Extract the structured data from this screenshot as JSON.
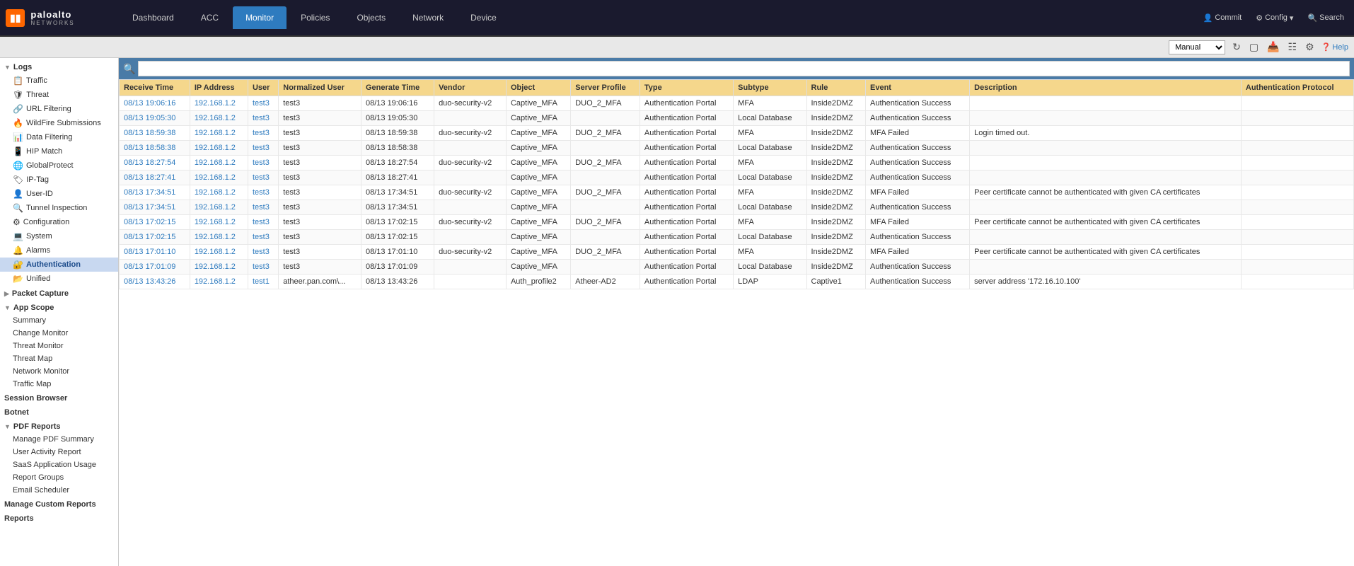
{
  "topbar": {
    "logo": "paloalto",
    "logo_sub": "NETWORKS",
    "nav_tabs": [
      {
        "label": "Dashboard",
        "active": false
      },
      {
        "label": "ACC",
        "active": false
      },
      {
        "label": "Monitor",
        "active": true
      },
      {
        "label": "Policies",
        "active": false
      },
      {
        "label": "Objects",
        "active": false
      },
      {
        "label": "Network",
        "active": false
      },
      {
        "label": "Device",
        "active": false
      }
    ],
    "commit_label": "Commit",
    "config_label": "Config",
    "search_label": "Search",
    "help_label": "Help",
    "manual_label": "Manual"
  },
  "sidebar": {
    "logs_section": {
      "label": "Logs",
      "items": [
        {
          "label": "Traffic",
          "icon": "📋"
        },
        {
          "label": "Threat",
          "icon": "🛡"
        },
        {
          "label": "URL Filtering",
          "icon": "🔗"
        },
        {
          "label": "WildFire Submissions",
          "icon": "🔥"
        },
        {
          "label": "Data Filtering",
          "icon": "📊"
        },
        {
          "label": "HIP Match",
          "icon": "📱"
        },
        {
          "label": "GlobalProtect",
          "icon": "🌐"
        },
        {
          "label": "IP-Tag",
          "icon": "🏷"
        },
        {
          "label": "User-ID",
          "icon": "👤"
        },
        {
          "label": "Tunnel Inspection",
          "icon": "🔍"
        },
        {
          "label": "Configuration",
          "icon": "⚙"
        },
        {
          "label": "System",
          "icon": "💻"
        },
        {
          "label": "Alarms",
          "icon": "🔔"
        },
        {
          "label": "Authentication",
          "icon": "🔐",
          "active": true
        },
        {
          "label": "Unified",
          "icon": "📂"
        }
      ]
    },
    "packet_capture": {
      "label": "Packet Capture"
    },
    "app_scope": {
      "label": "App Scope",
      "items": [
        {
          "label": "Summary"
        },
        {
          "label": "Change Monitor"
        },
        {
          "label": "Threat Monitor"
        },
        {
          "label": "Threat Map"
        },
        {
          "label": "Network Monitor"
        },
        {
          "label": "Traffic Map"
        }
      ]
    },
    "session_browser": {
      "label": "Session Browser"
    },
    "botnet": {
      "label": "Botnet"
    },
    "pdf_reports": {
      "label": "PDF Reports",
      "items": [
        {
          "label": "Manage PDF Summary"
        },
        {
          "label": "User Activity Report"
        },
        {
          "label": "SaaS Application Usage"
        },
        {
          "label": "Report Groups"
        },
        {
          "label": "Email Scheduler"
        }
      ]
    },
    "custom_reports": {
      "label": "Manage Custom Reports"
    },
    "reports": {
      "label": "Reports"
    }
  },
  "table": {
    "columns": [
      "Receive Time",
      "IP Address",
      "User",
      "Normalized User",
      "Generate Time",
      "Vendor",
      "Object",
      "Server Profile",
      "Type",
      "Subtype",
      "Rule",
      "Event",
      "Description",
      "Authentication Protocol"
    ],
    "rows": [
      {
        "receive_time": "08/13 19:06:16",
        "ip_address": "192.168.1.2",
        "user": "test3",
        "normalized_user": "test3",
        "generate_time": "08/13 19:06:16",
        "vendor": "duo-security-v2",
        "object": "Captive_MFA",
        "server_profile": "DUO_2_MFA",
        "type": "Authentication Portal",
        "subtype": "MFA",
        "rule": "Inside2DMZ",
        "event": "Authentication Success",
        "description": "",
        "auth_protocol": ""
      },
      {
        "receive_time": "08/13 19:05:30",
        "ip_address": "192.168.1.2",
        "user": "test3",
        "normalized_user": "test3",
        "generate_time": "08/13 19:05:30",
        "vendor": "",
        "object": "Captive_MFA",
        "server_profile": "",
        "type": "Authentication Portal",
        "subtype": "Local Database",
        "rule": "Inside2DMZ",
        "event": "Authentication Success",
        "description": "",
        "auth_protocol": ""
      },
      {
        "receive_time": "08/13 18:59:38",
        "ip_address": "192.168.1.2",
        "user": "test3",
        "normalized_user": "test3",
        "generate_time": "08/13 18:59:38",
        "vendor": "duo-security-v2",
        "object": "Captive_MFA",
        "server_profile": "DUO_2_MFA",
        "type": "Authentication Portal",
        "subtype": "MFA",
        "rule": "Inside2DMZ",
        "event": "MFA Failed",
        "description": "Login timed out.",
        "auth_protocol": ""
      },
      {
        "receive_time": "08/13 18:58:38",
        "ip_address": "192.168.1.2",
        "user": "test3",
        "normalized_user": "test3",
        "generate_time": "08/13 18:58:38",
        "vendor": "",
        "object": "Captive_MFA",
        "server_profile": "",
        "type": "Authentication Portal",
        "subtype": "Local Database",
        "rule": "Inside2DMZ",
        "event": "Authentication Success",
        "description": "",
        "auth_protocol": ""
      },
      {
        "receive_time": "08/13 18:27:54",
        "ip_address": "192.168.1.2",
        "user": "test3",
        "normalized_user": "test3",
        "generate_time": "08/13 18:27:54",
        "vendor": "duo-security-v2",
        "object": "Captive_MFA",
        "server_profile": "DUO_2_MFA",
        "type": "Authentication Portal",
        "subtype": "MFA",
        "rule": "Inside2DMZ",
        "event": "Authentication Success",
        "description": "",
        "auth_protocol": ""
      },
      {
        "receive_time": "08/13 18:27:41",
        "ip_address": "192.168.1.2",
        "user": "test3",
        "normalized_user": "test3",
        "generate_time": "08/13 18:27:41",
        "vendor": "",
        "object": "Captive_MFA",
        "server_profile": "",
        "type": "Authentication Portal",
        "subtype": "Local Database",
        "rule": "Inside2DMZ",
        "event": "Authentication Success",
        "description": "",
        "auth_protocol": ""
      },
      {
        "receive_time": "08/13 17:34:51",
        "ip_address": "192.168.1.2",
        "user": "test3",
        "normalized_user": "test3",
        "generate_time": "08/13 17:34:51",
        "vendor": "duo-security-v2",
        "object": "Captive_MFA",
        "server_profile": "DUO_2_MFA",
        "type": "Authentication Portal",
        "subtype": "MFA",
        "rule": "Inside2DMZ",
        "event": "MFA Failed",
        "description": "Peer certificate cannot be authenticated with given CA certificates",
        "auth_protocol": ""
      },
      {
        "receive_time": "08/13 17:34:51",
        "ip_address": "192.168.1.2",
        "user": "test3",
        "normalized_user": "test3",
        "generate_time": "08/13 17:34:51",
        "vendor": "",
        "object": "Captive_MFA",
        "server_profile": "",
        "type": "Authentication Portal",
        "subtype": "Local Database",
        "rule": "Inside2DMZ",
        "event": "Authentication Success",
        "description": "",
        "auth_protocol": ""
      },
      {
        "receive_time": "08/13 17:02:15",
        "ip_address": "192.168.1.2",
        "user": "test3",
        "normalized_user": "test3",
        "generate_time": "08/13 17:02:15",
        "vendor": "duo-security-v2",
        "object": "Captive_MFA",
        "server_profile": "DUO_2_MFA",
        "type": "Authentication Portal",
        "subtype": "MFA",
        "rule": "Inside2DMZ",
        "event": "MFA Failed",
        "description": "Peer certificate cannot be authenticated with given CA certificates",
        "auth_protocol": ""
      },
      {
        "receive_time": "08/13 17:02:15",
        "ip_address": "192.168.1.2",
        "user": "test3",
        "normalized_user": "test3",
        "generate_time": "08/13 17:02:15",
        "vendor": "",
        "object": "Captive_MFA",
        "server_profile": "",
        "type": "Authentication Portal",
        "subtype": "Local Database",
        "rule": "Inside2DMZ",
        "event": "Authentication Success",
        "description": "",
        "auth_protocol": ""
      },
      {
        "receive_time": "08/13 17:01:10",
        "ip_address": "192.168.1.2",
        "user": "test3",
        "normalized_user": "test3",
        "generate_time": "08/13 17:01:10",
        "vendor": "duo-security-v2",
        "object": "Captive_MFA",
        "server_profile": "DUO_2_MFA",
        "type": "Authentication Portal",
        "subtype": "MFA",
        "rule": "Inside2DMZ",
        "event": "MFA Failed",
        "description": "Peer certificate cannot be authenticated with given CA certificates",
        "auth_protocol": ""
      },
      {
        "receive_time": "08/13 17:01:09",
        "ip_address": "192.168.1.2",
        "user": "test3",
        "normalized_user": "test3",
        "generate_time": "08/13 17:01:09",
        "vendor": "",
        "object": "Captive_MFA",
        "server_profile": "",
        "type": "Authentication Portal",
        "subtype": "Local Database",
        "rule": "Inside2DMZ",
        "event": "Authentication Success",
        "description": "",
        "auth_protocol": ""
      },
      {
        "receive_time": "08/13 13:43:26",
        "ip_address": "192.168.1.2",
        "user": "test1",
        "normalized_user": "atheer.pan.com\\...",
        "generate_time": "08/13 13:43:26",
        "vendor": "",
        "object": "Auth_profile2",
        "server_profile": "Atheer-AD2",
        "type": "Authentication Portal",
        "subtype": "LDAP",
        "rule": "Captive1",
        "event": "Authentication Success",
        "description": "server address '172.16.10.100'",
        "auth_protocol": ""
      }
    ]
  }
}
